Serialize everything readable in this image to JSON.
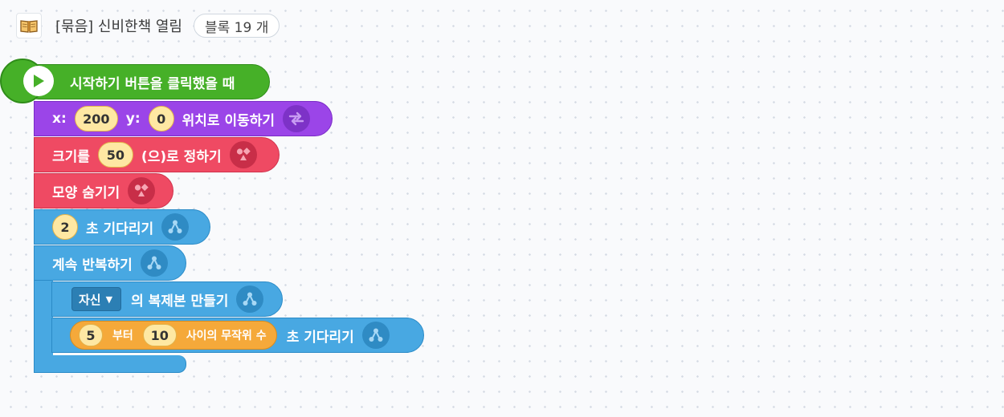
{
  "header": {
    "icon": "book-icon",
    "title": "[묶음] 신비한책 열림",
    "count": "블록 19 개"
  },
  "blocks": {
    "start": {
      "label": "시작하기 버튼을 클릭했을 때",
      "color": "#46b028"
    },
    "move": {
      "x_label": "x:",
      "x_value": "200",
      "y_label": "y:",
      "y_value": "0",
      "label": "위치로 이동하기",
      "icon": "swap-arrows-icon",
      "color": "#9b45e8"
    },
    "size": {
      "label_pre": "크기를",
      "value": "50",
      "label_post": "(으)로 정하기",
      "icon": "shape-icon",
      "color": "#ef4a63"
    },
    "hide": {
      "label": "모양 숨기기",
      "icon": "shape-icon",
      "color": "#ef4a63"
    },
    "wait": {
      "value": "2",
      "label": "초 기다리기",
      "icon": "flow-icon",
      "color": "#48a8e2"
    },
    "loop": {
      "label": "계속 반복하기",
      "icon": "flow-icon"
    },
    "clone": {
      "target": "자신",
      "label": "의 복제본 만들기",
      "icon": "flow-icon"
    },
    "random_wait": {
      "min": "5",
      "from_label": "부터",
      "max": "10",
      "range_label": "사이의 무작위 수",
      "label": "초 기다리기",
      "icon": "flow-icon",
      "reporter_color": "#f5a93a"
    }
  }
}
